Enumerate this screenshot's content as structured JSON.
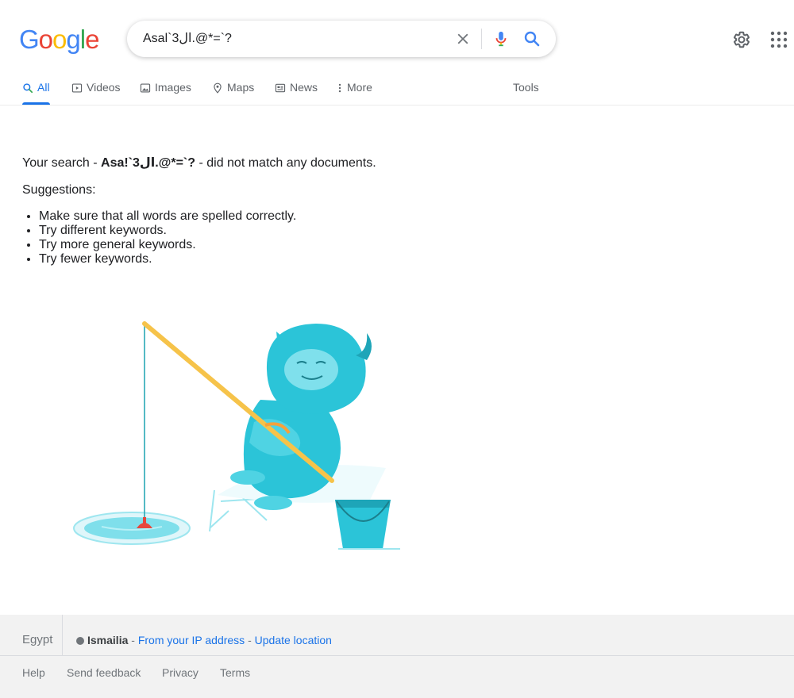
{
  "logo": {
    "letters": [
      "G",
      "o",
      "o",
      "g",
      "l",
      "e"
    ],
    "colors": [
      "#4285f4",
      "#ea4335",
      "#fbbc05",
      "#4285f4",
      "#34a853",
      "#ea4335"
    ]
  },
  "search": {
    "query": "Asal`3ال.@*=`?",
    "clear_icon": "close-icon",
    "mic_icon": "microphone-icon",
    "search_icon": "search-icon"
  },
  "header": {
    "settings_icon": "gear-icon",
    "apps_icon": "apps-grid-icon"
  },
  "tabs": [
    {
      "label": "All",
      "icon": "search-icon",
      "active": true
    },
    {
      "label": "Videos",
      "icon": "video-icon",
      "active": false
    },
    {
      "label": "Images",
      "icon": "image-icon",
      "active": false
    },
    {
      "label": "Maps",
      "icon": "map-pin-icon",
      "active": false
    },
    {
      "label": "News",
      "icon": "news-icon",
      "active": false
    },
    {
      "label": "More",
      "icon": "more-vert-icon",
      "active": false
    }
  ],
  "tools_label": "Tools",
  "results": {
    "prefix": "Your search - ",
    "query_bold": "Asa!`3ال.@*=`?",
    "suffix": " - did not match any documents.",
    "suggestions_label": "Suggestions:",
    "suggestions": [
      "Make sure that all words are spelled correctly.",
      "Try different keywords.",
      "Try more general keywords.",
      "Try fewer keywords."
    ]
  },
  "footer": {
    "country": "Egypt",
    "city": "Ismailia",
    "sep1": " - ",
    "from_ip": "From your IP address",
    "sep2": " - ",
    "update_location": "Update location",
    "links": [
      "Help",
      "Send feedback",
      "Privacy",
      "Terms"
    ]
  },
  "colors": {
    "accent": "#1a73e8",
    "text_secondary": "#5f6368",
    "footer_bg": "#f2f2f2",
    "yeti": "#2bc4d8",
    "rod": "#f6c34a",
    "float": "#e8453c"
  }
}
